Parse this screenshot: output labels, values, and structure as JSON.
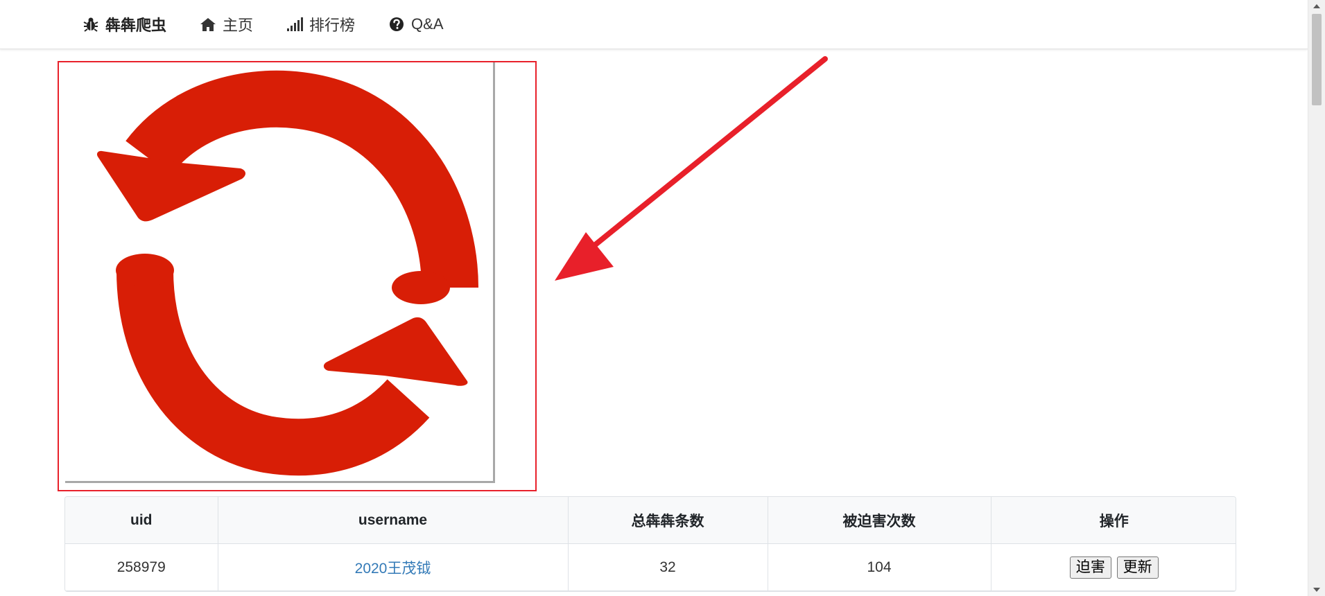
{
  "navbar": {
    "brand_label": "犇犇爬虫",
    "brand_icon": "bug-icon",
    "items": [
      {
        "label": "主页",
        "icon": "home-icon"
      },
      {
        "label": "排行榜",
        "icon": "signal-bars-icon"
      },
      {
        "label": "Q&A",
        "icon": "question-circle-icon"
      }
    ]
  },
  "captcha": {
    "icon": "refresh-icon",
    "icon_color": "#d81e06",
    "highlight_color": "#e8202a"
  },
  "annotation": {
    "arrow_color": "#e8202a"
  },
  "table": {
    "columns": [
      "uid",
      "username",
      "总犇犇条数",
      "被迫害次数",
      "操作"
    ],
    "rows": [
      {
        "uid": "258979",
        "username": "2020王茂钺",
        "total": "32",
        "persecuted": "104",
        "actions": [
          "迫害",
          "更新"
        ]
      }
    ]
  }
}
